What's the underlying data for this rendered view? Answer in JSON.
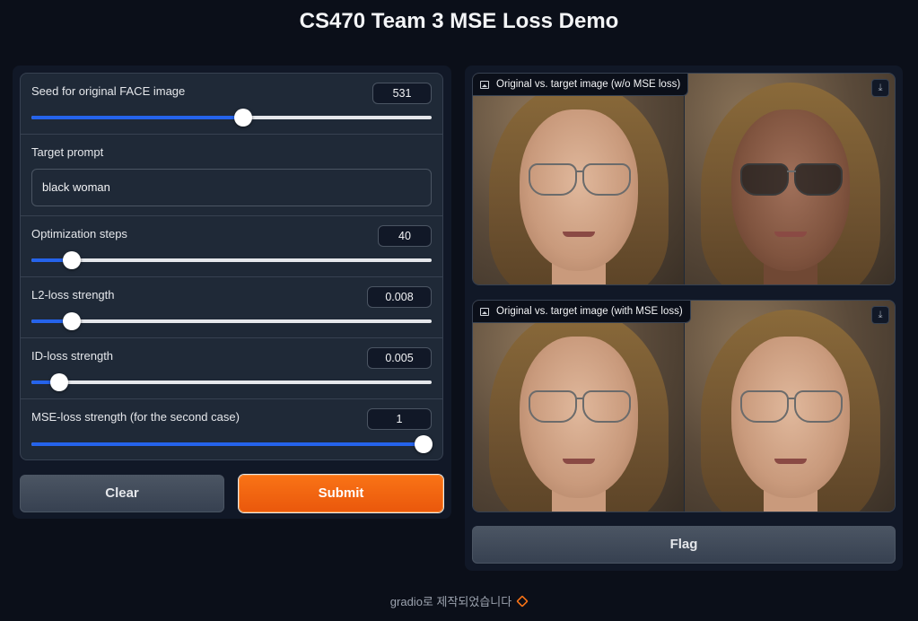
{
  "title": "CS470 Team 3 MSE Loss Demo",
  "controls": {
    "seed": {
      "label": "Seed for original FACE image",
      "value": "531",
      "level": 0.53
    },
    "prompt": {
      "label": "Target prompt",
      "value": "black woman"
    },
    "steps": {
      "label": "Optimization steps",
      "value": "40",
      "level": 0.1
    },
    "l2": {
      "label": "L2-loss strength",
      "value": "0.008",
      "level": 0.1
    },
    "id": {
      "label": "ID-loss strength",
      "value": "0.005",
      "level": 0.07
    },
    "mse": {
      "label": "MSE-loss strength (for the second case)",
      "value": "1",
      "level": 0.98
    }
  },
  "buttons": {
    "clear": "Clear",
    "submit": "Submit",
    "flag": "Flag"
  },
  "outputs": {
    "without_mse": {
      "label": "Original vs. target image (w/o MSE loss)"
    },
    "with_mse": {
      "label": "Original vs. target image (with MSE loss)"
    }
  },
  "footer": {
    "text": "gradio로 제작되었습니다"
  },
  "colors": {
    "accent": "#2563eb",
    "submit": "#f97316",
    "background": "#0b0f19"
  },
  "icons": {
    "image": "image-icon",
    "download": "download-icon",
    "logo": "gradio-logo-icon"
  }
}
